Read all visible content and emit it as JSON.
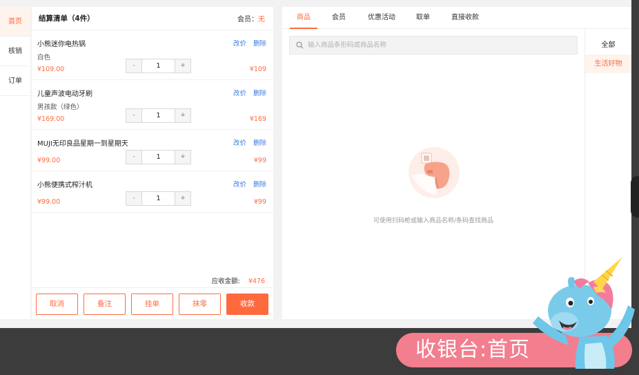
{
  "nav": {
    "items": [
      {
        "label": "首页",
        "active": true
      },
      {
        "label": "核销",
        "active": false
      },
      {
        "label": "订单",
        "active": false
      }
    ]
  },
  "cart": {
    "title": "结算清单（4件）",
    "member_label": "会员：",
    "member_value": "无",
    "edit_price": "改价",
    "delete": "删除",
    "items": [
      {
        "name": "小熊迷你电热锅",
        "spec": "白色",
        "unit_price": "¥109.00",
        "qty": "1",
        "total": "¥109"
      },
      {
        "name": "儿童声波电动牙刷",
        "spec": "男孩款（绿色）",
        "unit_price": "¥169.00",
        "qty": "1",
        "total": "¥169"
      },
      {
        "name": "MUJI无印良品星期一到星期天",
        "spec": "",
        "unit_price": "¥99.00",
        "qty": "1",
        "total": "¥99"
      },
      {
        "name": "小熊便携式榨汁机",
        "spec": "",
        "unit_price": "¥99.00",
        "qty": "1",
        "total": "¥99"
      }
    ],
    "stepper_minus": "-",
    "stepper_plus": "+",
    "total_label": "应收金额:",
    "total_value": "¥476",
    "actions": {
      "cancel": "取消",
      "note": "备注",
      "hold": "挂单",
      "round_off": "抹零",
      "checkout": "收款"
    }
  },
  "products": {
    "tabs": [
      {
        "label": "商品",
        "active": true
      },
      {
        "label": "会员",
        "active": false
      },
      {
        "label": "优惠活动",
        "active": false
      },
      {
        "label": "取单",
        "active": false
      },
      {
        "label": "直接收款",
        "active": false
      }
    ],
    "search_placeholder": "输入商品条形码或商品名称",
    "categories": [
      {
        "label": "全部",
        "active": false
      },
      {
        "label": "生活好物",
        "active": true
      }
    ],
    "empty_hint": "可使用扫码枪或输入商品名称/条码查找商品"
  },
  "banner": {
    "caption": "收银台:首页"
  },
  "colors": {
    "accent": "#ff6a3d",
    "link": "#3a7be0",
    "pill": "#f37e8e",
    "band": "#3c3c3c"
  }
}
